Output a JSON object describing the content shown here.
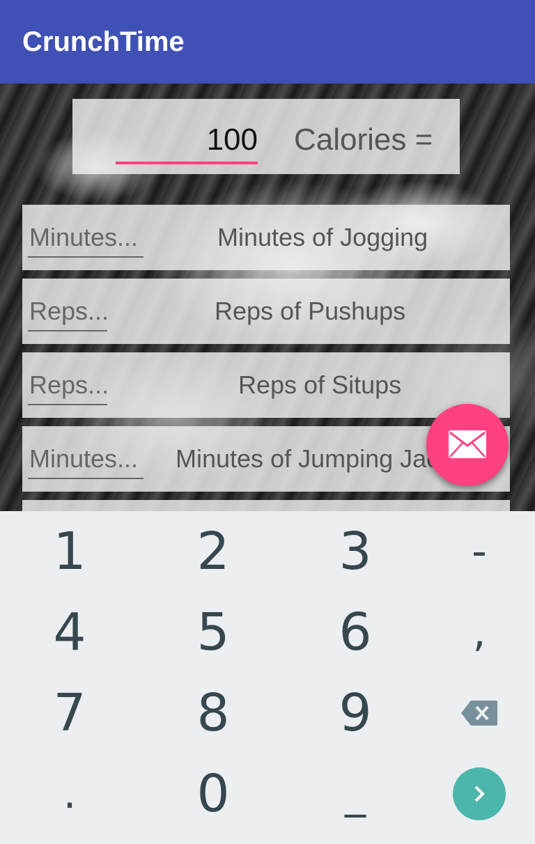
{
  "app": {
    "title": "CrunchTime"
  },
  "calories": {
    "value": "100",
    "label": "Calories ="
  },
  "exercises": [
    {
      "field_placeholder": "Minutes...",
      "label": "Minutes of Jogging"
    },
    {
      "field_placeholder": "Reps...",
      "label": "Reps of Pushups"
    },
    {
      "field_placeholder": "Reps...",
      "label": "Reps of Situps"
    },
    {
      "field_placeholder": "Minutes...",
      "label": "Minutes of Jumping Jacks"
    }
  ],
  "fab": {
    "icon": "email-icon",
    "color": "#ff4081"
  },
  "keyboard": {
    "keys": [
      "1",
      "2",
      "3",
      "-",
      "4",
      "5",
      "6",
      ",",
      "7",
      "8",
      "9",
      "⌫",
      ".",
      "0",
      "_",
      "go"
    ],
    "accent": "#4db6ac"
  },
  "colors": {
    "appbar": "#3f51b5",
    "accent": "#ff4081",
    "keyboard_bg": "#eceff1"
  }
}
